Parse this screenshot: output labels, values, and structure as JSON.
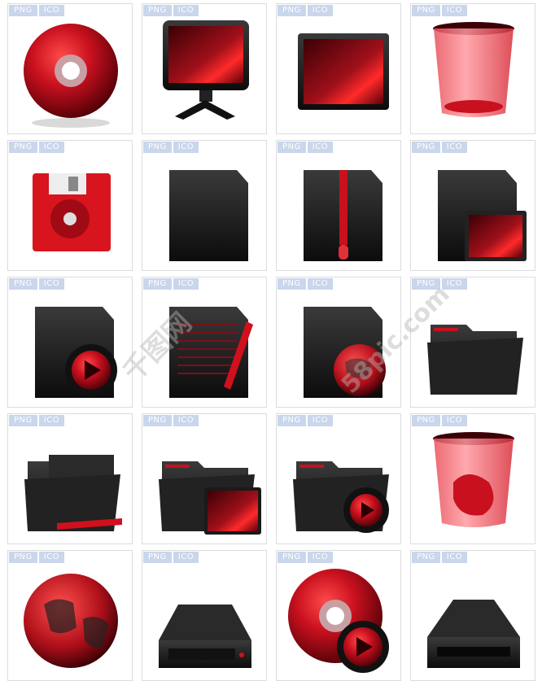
{
  "tags": {
    "png": "PNG",
    "ico": "ICO"
  },
  "icons": [
    "cd-disc-icon",
    "monitor-icon",
    "screen-icon",
    "recycle-bin-empty-icon",
    "floppy-disk-icon",
    "blank-file-icon",
    "zip-file-icon",
    "image-file-icon",
    "media-file-icon",
    "text-document-icon",
    "web-file-icon",
    "folder-icon",
    "documents-folder-icon",
    "pictures-folder-icon",
    "media-folder-icon",
    "recycle-bin-full-icon",
    "globe-icon",
    "hard-drive-icon",
    "dvd-media-icon",
    "removable-drive-icon"
  ],
  "watermark": {
    "left": "千图网",
    "right": "58pic.com"
  },
  "colors": {
    "red": "#c8101e",
    "dark": "#151515",
    "tag_bg": "#c9d6ec"
  }
}
